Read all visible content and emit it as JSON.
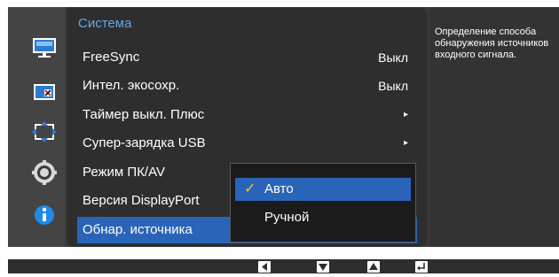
{
  "menu": {
    "title": "Система",
    "items": [
      {
        "label": "FreeSync",
        "value": "Выкл"
      },
      {
        "label": "Интел. экосохр.",
        "value": "Выкл"
      },
      {
        "label": "Таймер выкл. Плюс",
        "arrow": "▸"
      },
      {
        "label": "Супер-зарядка USB",
        "arrow": "▸"
      },
      {
        "label": "Режим ПК/AV"
      },
      {
        "label": "Версия DisplayPort"
      },
      {
        "label": "Обнар. источника"
      }
    ],
    "selected_index": 6
  },
  "submenu": {
    "options": [
      {
        "label": "Авто",
        "checked": true
      },
      {
        "label": "Ручной",
        "checked": false
      }
    ],
    "check_glyph": "✓"
  },
  "help": {
    "text": "Определение способа обнаружения источников входного сигнала."
  },
  "icons": [
    "monitor-icon",
    "picture-icon",
    "onscreen-display-icon",
    "system-gear-icon",
    "info-icon"
  ],
  "bottom_buttons": [
    "left-button",
    "down-button",
    "up-button",
    "enter-button"
  ],
  "colors": {
    "accent": "#2a64b8",
    "title": "#5fa8e8",
    "check": "#f0c020",
    "info_icon": "#1d8be8"
  }
}
